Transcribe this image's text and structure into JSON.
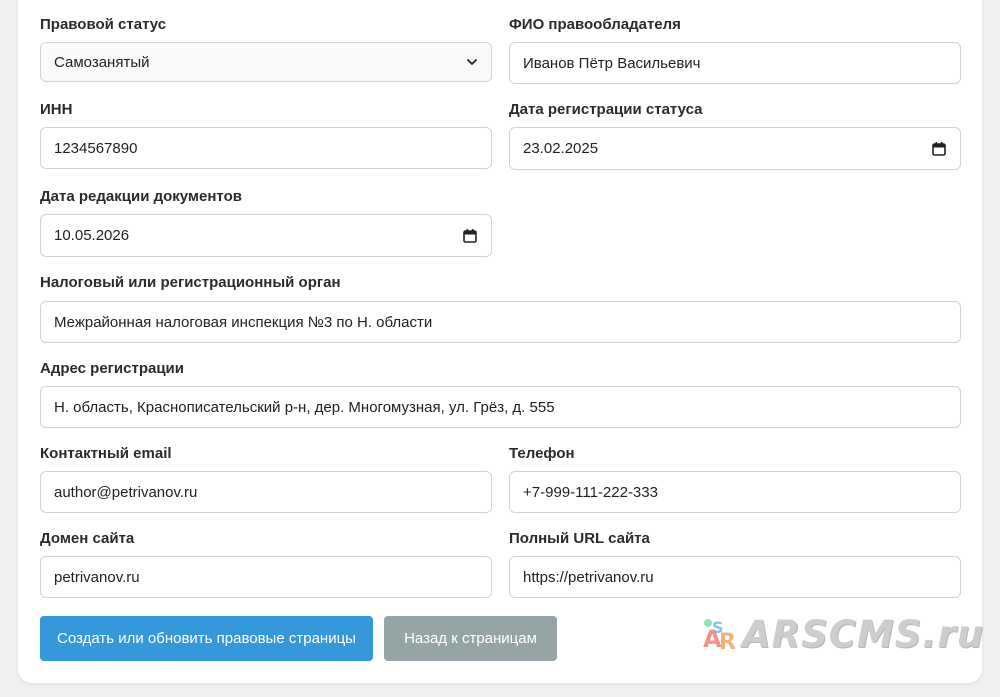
{
  "form": {
    "legal_status": {
      "label": "Правовой статус",
      "value": "Самозанятый"
    },
    "owner_name": {
      "label": "ФИО правообладателя",
      "value": "Иванов Пётр Васильевич"
    },
    "inn": {
      "label": "ИНН",
      "value": "1234567890"
    },
    "status_date": {
      "label": "Дата регистрации статуса",
      "value": "23.02.2025"
    },
    "docs_date": {
      "label": "Дата редакции документов",
      "value": "10.05.2026"
    },
    "tax_authority": {
      "label": "Налоговый или регистрационный орган",
      "value": "Межрайонная налоговая инспекция №3 по Н. области"
    },
    "address": {
      "label": "Адрес регистрации",
      "value": "Н. область, Краснописательский р-н, дер. Многомузная, ул. Грёз, д. 555"
    },
    "email": {
      "label": "Контактный email",
      "value": "author@petrivanov.ru"
    },
    "phone": {
      "label": "Телефон",
      "value": "+7-999-111-222-333"
    },
    "domain": {
      "label": "Домен сайта",
      "value": "petrivanov.ru"
    },
    "url": {
      "label": "Полный URL сайта",
      "value": "https://petrivanov.ru"
    }
  },
  "buttons": {
    "submit_label": "Создать или обновить правовые страницы",
    "back_label": "Назад к страницам"
  },
  "watermark": {
    "text": "ARSCMS.ru"
  },
  "icons": {
    "select": "chevron-down-icon",
    "date": "calendar-icon"
  },
  "colors": {
    "primary_button": "#3498db",
    "secondary_button": "#95a5a6"
  }
}
